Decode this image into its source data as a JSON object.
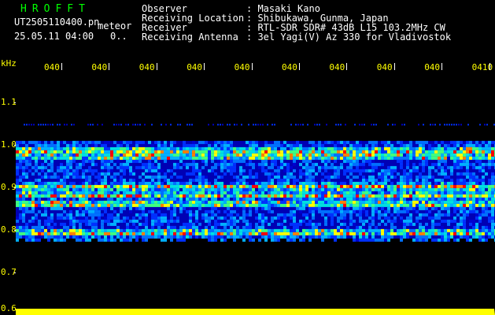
{
  "header": {
    "brand": "HROFFT",
    "filename": "UT2505110400.pn",
    "meteor_label": "meteor",
    "datetime": "25.05.11 04:00",
    "count": "0..",
    "info_labels": [
      "Observer",
      "Receiving Location",
      "Receiver",
      "Receiving Antenna"
    ],
    "info_values": [
      ": Masaki Kano",
      ": Shibukawa, Gunma, Japan",
      ": RTL-SDR SDR# 43dB L15 103.2MHz CW",
      ": 3el Yagi(V) Az 330 for Vladivostok"
    ]
  },
  "colors": {
    "background": "#000000",
    "label": "#ffff00",
    "brand": "#00ff00",
    "text": "#ffffff",
    "spectrum_low": "#0000c8",
    "spectrum_high": "#ff0000",
    "power_band": "#ffff00"
  },
  "chart_data": {
    "type": "heatmap",
    "y_unit": "kHz",
    "y_ticks": [
      0.6,
      0.7,
      0.8,
      0.9,
      1.0,
      1.1
    ],
    "y_tick_labels": [
      "0.6",
      "0.7",
      "0.8",
      "0.9",
      "1.0",
      "1.1"
    ],
    "ylim": [
      0.6,
      1.16
    ],
    "x_tick_labels": [
      "040",
      "040",
      "040",
      "040",
      "040",
      "040",
      "040",
      "040",
      "040",
      "0410"
    ],
    "signal_band_khz": [
      0.78,
      1.01
    ],
    "strong_lines_khz": [
      0.797,
      0.865,
      0.885,
      0.905,
      0.977,
      0.99
    ],
    "faint_line_khz": 1.05,
    "power_level": 0.9
  }
}
